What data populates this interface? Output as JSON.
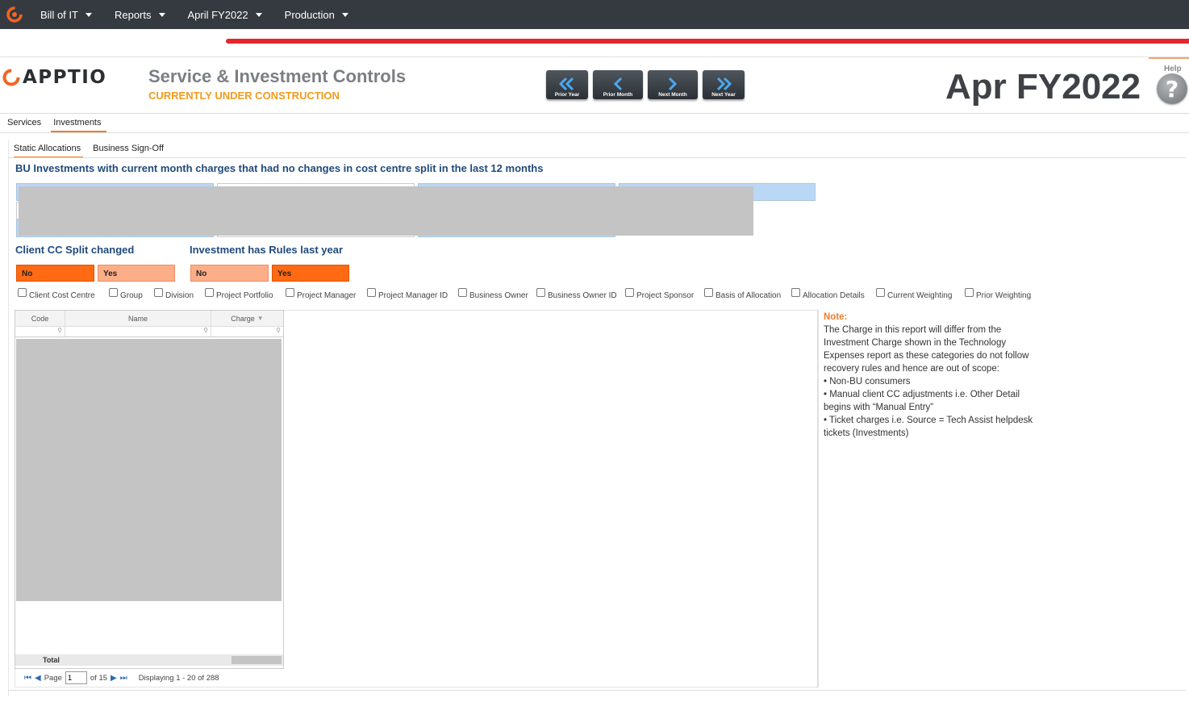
{
  "nav": {
    "menus": [
      "Bill of IT",
      "Reports",
      "April FY2022",
      "Production"
    ]
  },
  "header": {
    "brand": "APPTIO",
    "title": "Service & Investment Controls",
    "subtitle": "CURRENTLY UNDER CONSTRUCTION",
    "period": "Apr FY2022",
    "help_label": "Help",
    "nav_buttons": [
      "Prior Year",
      "Prior Month",
      "Next Month",
      "Next Year"
    ]
  },
  "tabs": {
    "level1": [
      "Services",
      "Investments"
    ],
    "level2": [
      "Static Allocations",
      "Business Sign-Off"
    ]
  },
  "section_title": "BU Investments with current month charges that had no changes in cost centre split in the last 12 months",
  "toggles": {
    "client_cc": {
      "title": "Client CC Split changed",
      "no": "No",
      "yes": "Yes"
    },
    "rules": {
      "title": "Investment has Rules last year",
      "no": "No",
      "yes": "Yes"
    }
  },
  "columns_options": [
    "Client Cost Centre",
    "Group",
    "Division",
    "Project Portfolio",
    "Project Manager",
    "Project Manager ID",
    "Business Owner",
    "Business Owner ID",
    "Project Sponsor",
    "Basis of Allocation",
    "Allocation Details",
    "Current Weighting",
    "Prior Weighting"
  ],
  "grid": {
    "headers": [
      "Code",
      "Name",
      "Charge"
    ],
    "total_label": "Total",
    "pager": {
      "page_label": "Page",
      "page_value": "1",
      "of_label": "of 15",
      "displaying": "Displaying 1 - 20 of 288"
    }
  },
  "note": {
    "title": "Note:",
    "body": "The Charge in this report will differ from the Investment Charge shown in the Technology Expenses report as these categories do not follow recovery rules and hence are out of scope:",
    "bullets": [
      "• Non-BU consumers",
      "• Manual client CC adjustments i.e. Other Detail begins with “Manual Entry”",
      "• Ticket charges i.e. Source = Tech Assist helpdesk tickets (Investments)"
    ]
  },
  "colors": {
    "accent": "#f07d2c",
    "nav_bg": "#353a40",
    "title_blue": "#1f4a7c",
    "toggle_on": "#ff6a13",
    "toggle_off": "#fcae88"
  }
}
